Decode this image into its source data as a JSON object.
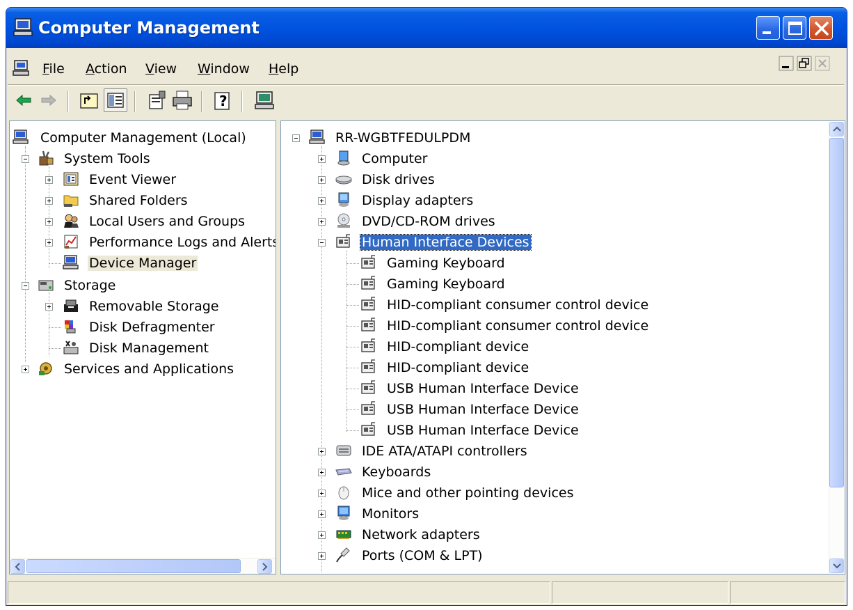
{
  "window": {
    "title": "Computer Management",
    "title_icon": "computer-management-icon"
  },
  "menu": [
    {
      "label": "File",
      "ul": "F",
      "rest": "ile"
    },
    {
      "label": "Action",
      "ul": "A",
      "rest": "ction"
    },
    {
      "label": "View",
      "ul": "V",
      "rest": "iew"
    },
    {
      "label": "Window",
      "ul": "W",
      "rest": "indow"
    },
    {
      "label": "Help",
      "ul": "H",
      "rest": "elp"
    }
  ],
  "toolbar": [
    "back-arrow-icon",
    "forward-arrow-icon",
    "up-one-level-icon",
    "show-hide-console-tree-icon",
    "properties-icon",
    "print-icon",
    "help-icon",
    "device-manager-icon"
  ],
  "left_tree": {
    "root": "Computer Management (Local)",
    "system_tools": "System Tools",
    "event_viewer": "Event Viewer",
    "shared_folders": "Shared Folders",
    "local_users": "Local Users and Groups",
    "perf_logs": "Performance Logs and Alerts",
    "device_manager": "Device Manager",
    "storage": "Storage",
    "removable_storage": "Removable Storage",
    "disk_defrag": "Disk Defragmenter",
    "disk_mgmt": "Disk Management",
    "services_apps": "Services and Applications"
  },
  "right_tree": {
    "root": "RR-WGBTFEDULPDM",
    "categories_top": [
      "Computer",
      "Disk drives",
      "Display adapters",
      "DVD/CD-ROM drives"
    ],
    "expanded_category": "Human Interface Devices",
    "hid_devices": [
      "Gaming Keyboard",
      "Gaming Keyboard",
      "HID-compliant consumer control device",
      "HID-compliant consumer control device",
      "HID-compliant device",
      "HID-compliant device",
      "USB Human Interface Device",
      "USB Human Interface Device",
      "USB Human Interface Device"
    ],
    "categories_bottom": [
      "IDE ATA/ATAPI controllers",
      "Keyboards",
      "Mice and other pointing devices",
      "Monitors",
      "Network adapters",
      "Ports (COM & LPT)"
    ]
  },
  "colors": {
    "title_bar": "#0053e0",
    "selection": "#316ac5",
    "window_bg": "#ece9d8"
  }
}
